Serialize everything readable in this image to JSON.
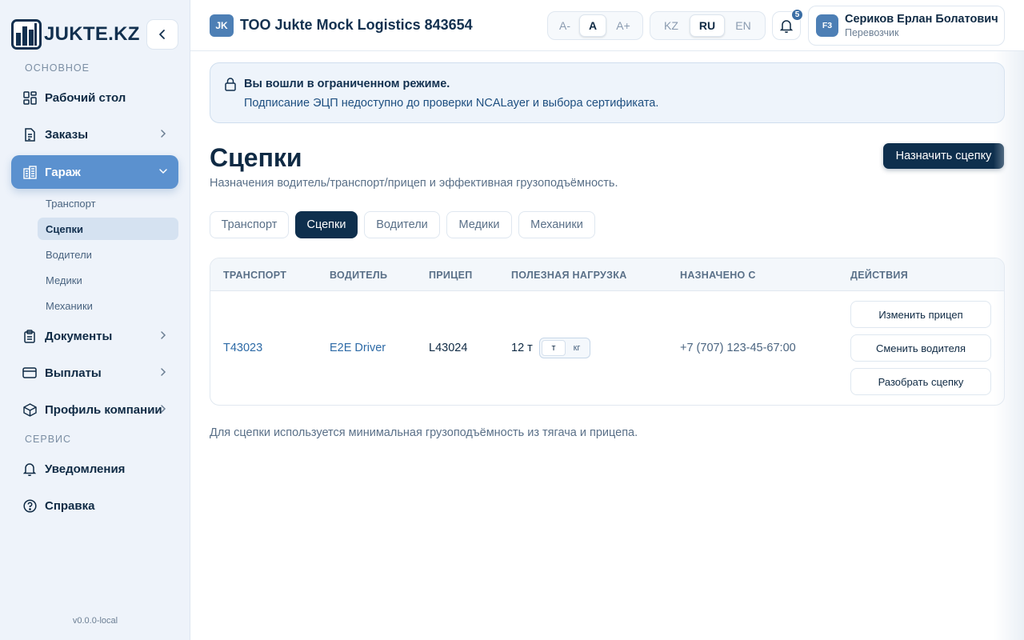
{
  "brand": {
    "logo_text": "JUKTE.KZ"
  },
  "sidebar": {
    "section_main": "ОСНОВНОЕ",
    "section_service": "СЕРВИС",
    "items": [
      {
        "label": "Рабочий стол"
      },
      {
        "label": "Заказы"
      },
      {
        "label": "Гараж"
      },
      {
        "label": "Документы"
      },
      {
        "label": "Выплаты"
      },
      {
        "label": "Профиль компании"
      },
      {
        "label": "Уведомления"
      },
      {
        "label": "Справка"
      }
    ],
    "garage_sub": [
      {
        "label": "Транспорт"
      },
      {
        "label": "Сцепки"
      },
      {
        "label": "Водители"
      },
      {
        "label": "Медики"
      },
      {
        "label": "Механики"
      }
    ],
    "version": "v0.0.0-local"
  },
  "header": {
    "company_badge": "JK",
    "company_name": "ТОО Jukte Mock Logistics 843654",
    "font_sizes": [
      "A-",
      "A",
      "A+"
    ],
    "languages": [
      "KZ",
      "RU",
      "EN"
    ],
    "active_language": "RU",
    "notifications_count": "5",
    "user": {
      "initials": "F3",
      "name": "Сериков Ерлан Болатович",
      "role": "Перевозчик"
    }
  },
  "alert": {
    "title": "Вы вошли в ограниченном режиме.",
    "text": "Подписание ЭЦП недоступно до проверки NCALayer и выбора сертификата."
  },
  "page": {
    "title": "Сцепки",
    "subtitle": "Назначения водитель/транспорт/прицеп и эффективная грузоподъёмность.",
    "primary_action": "Назначить сцепку",
    "tabs": [
      "Транспорт",
      "Сцепки",
      "Водители",
      "Медики",
      "Механики"
    ],
    "active_tab": "Сцепки"
  },
  "table": {
    "columns": [
      "ТРАНСПОРТ",
      "ВОДИТЕЛЬ",
      "ПРИЦЕП",
      "ПОЛЕЗНАЯ НАГРУЗКА",
      "НАЗНАЧЕНО С",
      "ДЕЙСТВИЯ"
    ],
    "rows": [
      {
        "transport": "T43023",
        "driver": "E2E Driver",
        "trailer": "L43024",
        "payload": "12 т",
        "units": [
          "т",
          "кг"
        ],
        "assigned_since": "+7 (707) 123-45-67:00",
        "actions": [
          "Изменить прицеп",
          "Сменить водителя",
          "Разобрать сцепку"
        ]
      }
    ]
  },
  "footnote": "Для сцепки используется минимальная грузоподъёмность из тягача и прицепа.",
  "colors": {
    "brand_dark": "#0e2f4d",
    "accent": "#5b91cf",
    "link": "#2d6aa6"
  }
}
